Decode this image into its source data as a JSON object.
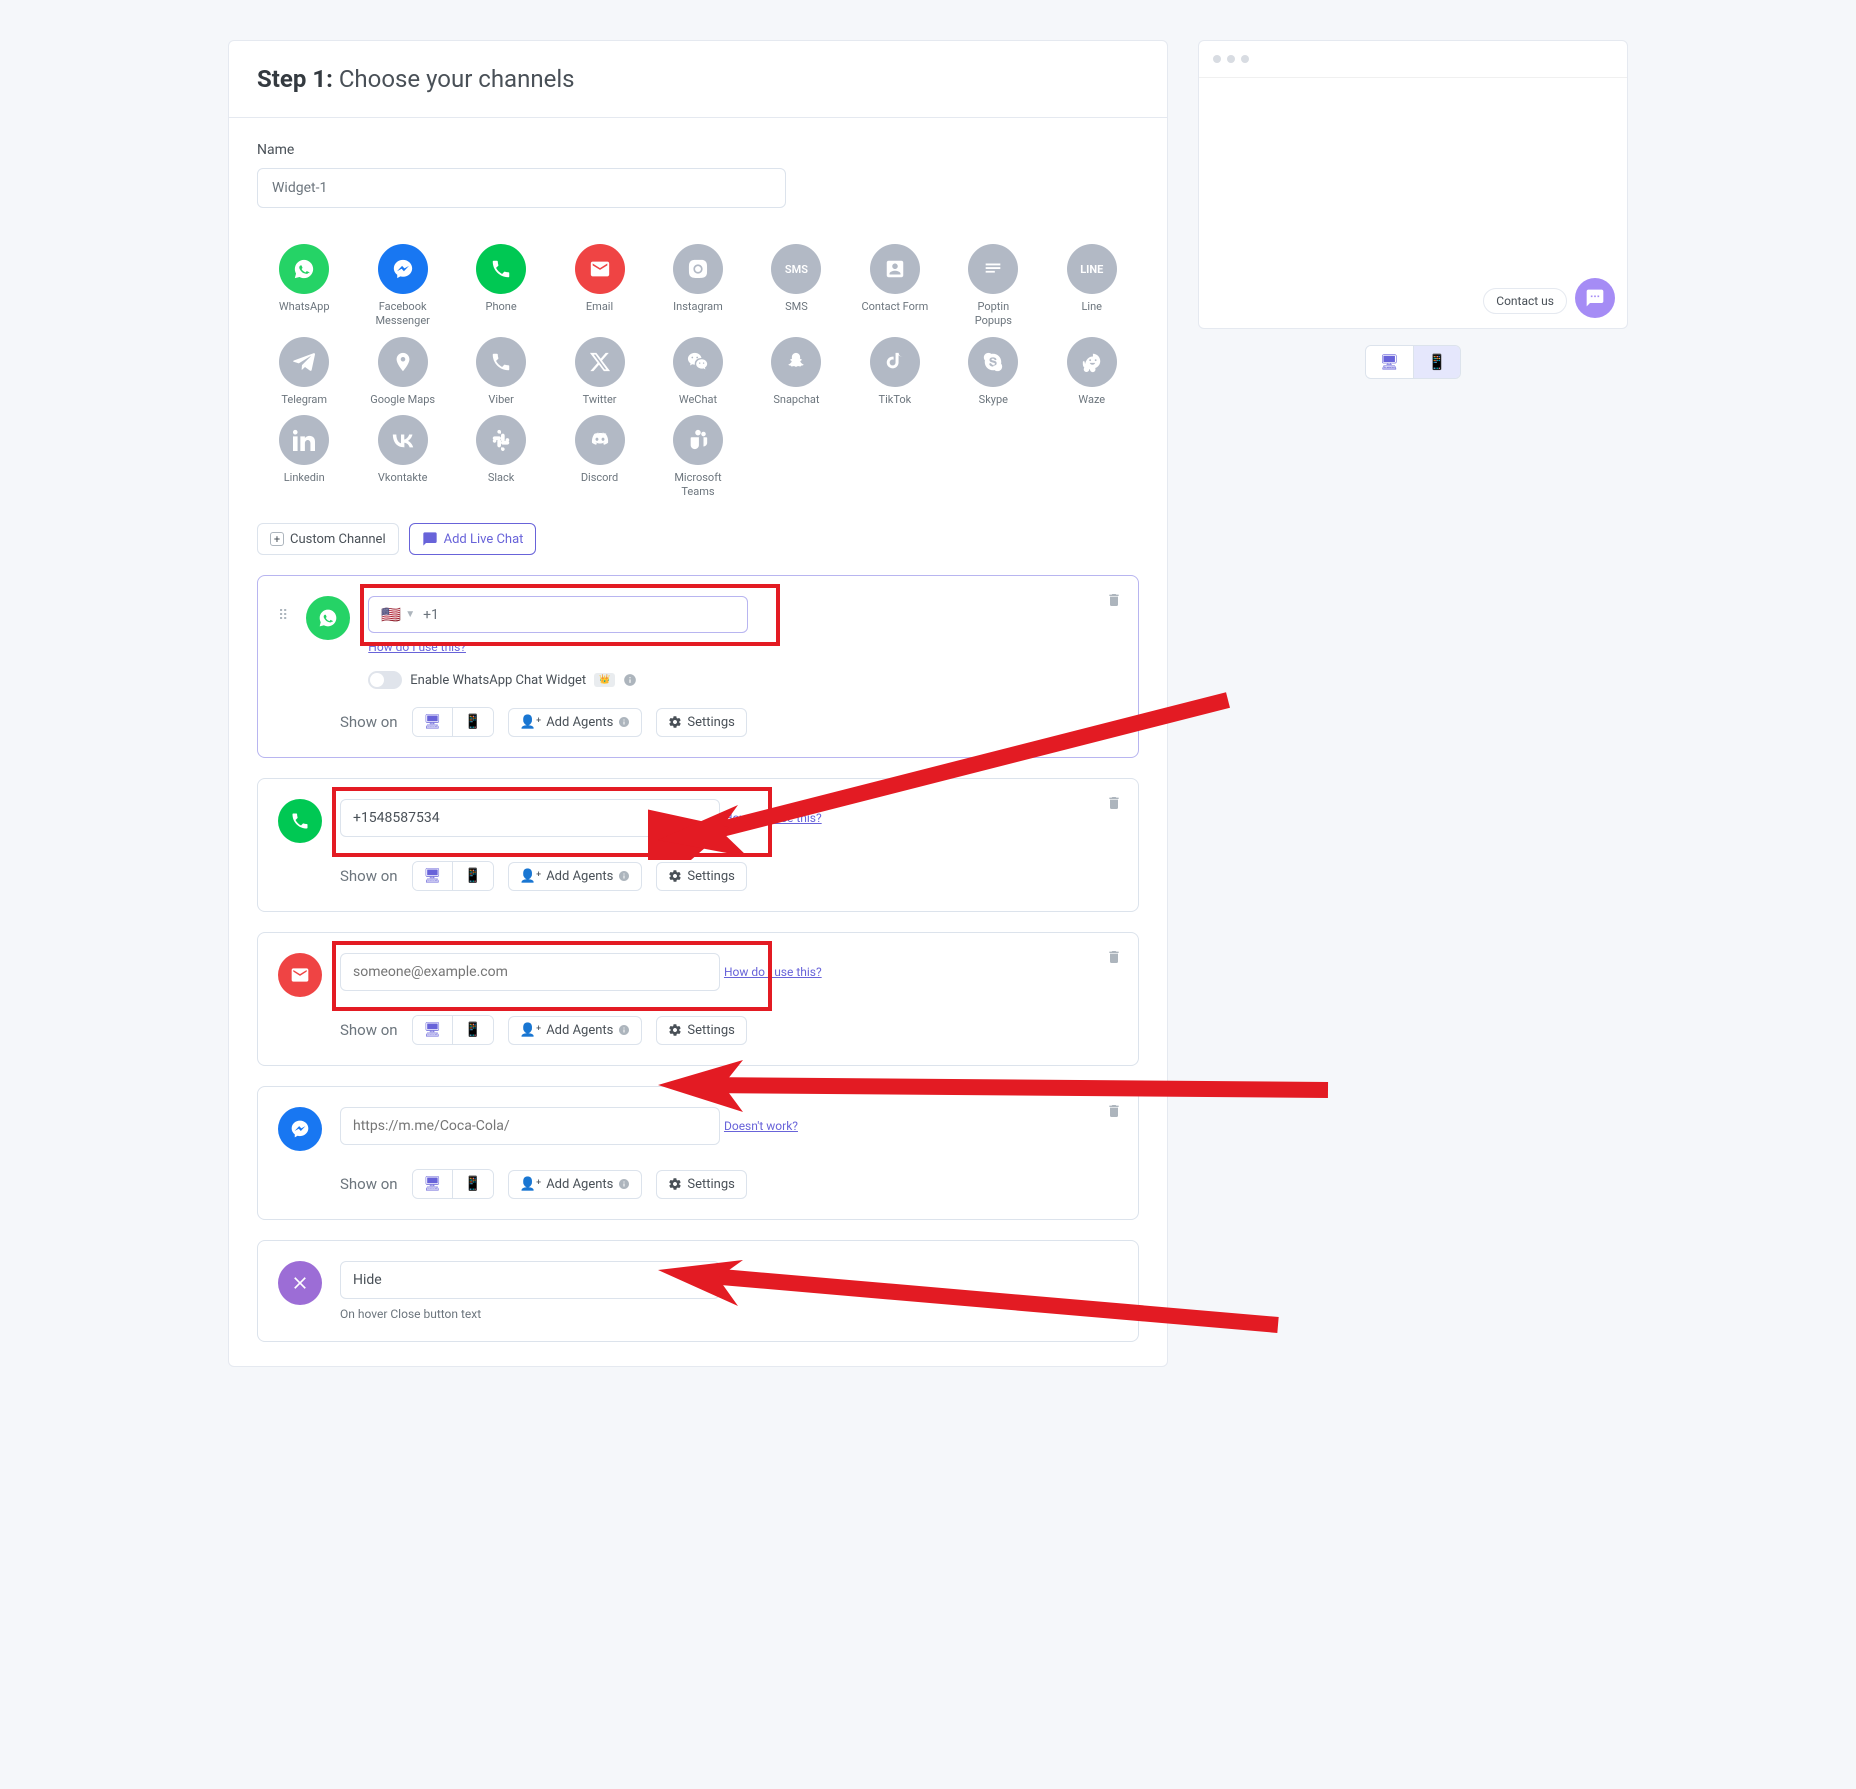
{
  "step": {
    "prefix": "Step 1:",
    "title": "Choose your channels"
  },
  "name": {
    "label": "Name",
    "value": "Widget-1"
  },
  "channels": [
    "WhatsApp",
    "Facebook Messenger",
    "Phone",
    "Email",
    "Instagram",
    "SMS",
    "Contact Form",
    "Poptin Popups",
    "Line",
    "Telegram",
    "Google Maps",
    "Viber",
    "Twitter",
    "WeChat",
    "Snapchat",
    "TikTok",
    "Skype",
    "Waze",
    "Linkedin",
    "Vkontakte",
    "Slack",
    "Discord",
    "Microsoft Teams"
  ],
  "buttons": {
    "custom": "Custom Channel",
    "live": "Add Live Chat"
  },
  "cards": {
    "whatsapp": {
      "dial": "+1",
      "help": "How do I use this?",
      "toggle_label": "Enable WhatsApp Chat Widget"
    },
    "phone": {
      "value": "+1548587534",
      "help": "How do I use this?"
    },
    "email": {
      "placeholder": "someone@example.com",
      "help": "How do I use this?"
    },
    "messenger": {
      "placeholder": "https://m.me/Coca-Cola/",
      "help": "Doesn't work?"
    },
    "close": {
      "value": "Hide",
      "hint": "On hover Close button text"
    }
  },
  "common": {
    "show_on": "Show on",
    "add_agents": "Add Agents",
    "settings": "Settings"
  },
  "preview": {
    "contact": "Contact us"
  }
}
